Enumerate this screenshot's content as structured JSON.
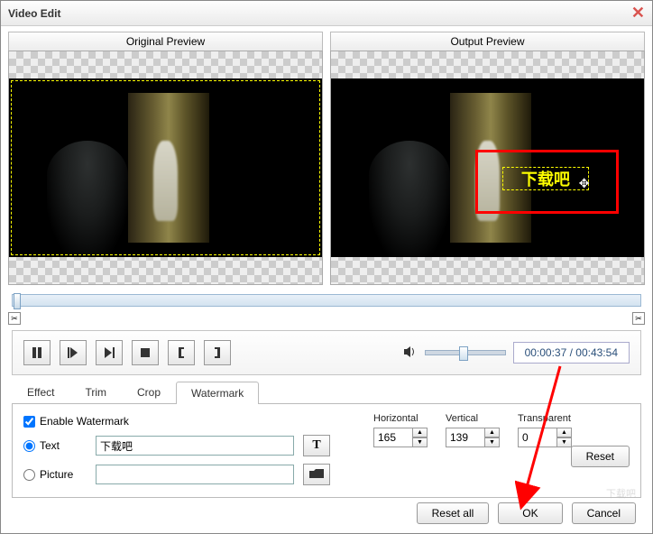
{
  "window": {
    "title": "Video Edit"
  },
  "preview": {
    "original": "Original Preview",
    "output": "Output Preview"
  },
  "watermark_text": "下载吧",
  "playback": {
    "time": "00:00:37 / 00:43:54"
  },
  "tabs": {
    "effect": "Effect",
    "trim": "Trim",
    "crop": "Crop",
    "watermark": "Watermark"
  },
  "wm": {
    "enable": "Enable Watermark",
    "text_label": "Text",
    "picture_label": "Picture",
    "text_value": "下载吧",
    "picture_value": ""
  },
  "pos": {
    "horizontal_label": "Horizontal",
    "horizontal_value": "165",
    "vertical_label": "Vertical",
    "vertical_value": "139",
    "transparent_label": "Transparent",
    "transparent_value": "0"
  },
  "buttons": {
    "reset": "Reset",
    "reset_all": "Reset all",
    "ok": "OK",
    "cancel": "Cancel"
  },
  "faint": "下载吧"
}
